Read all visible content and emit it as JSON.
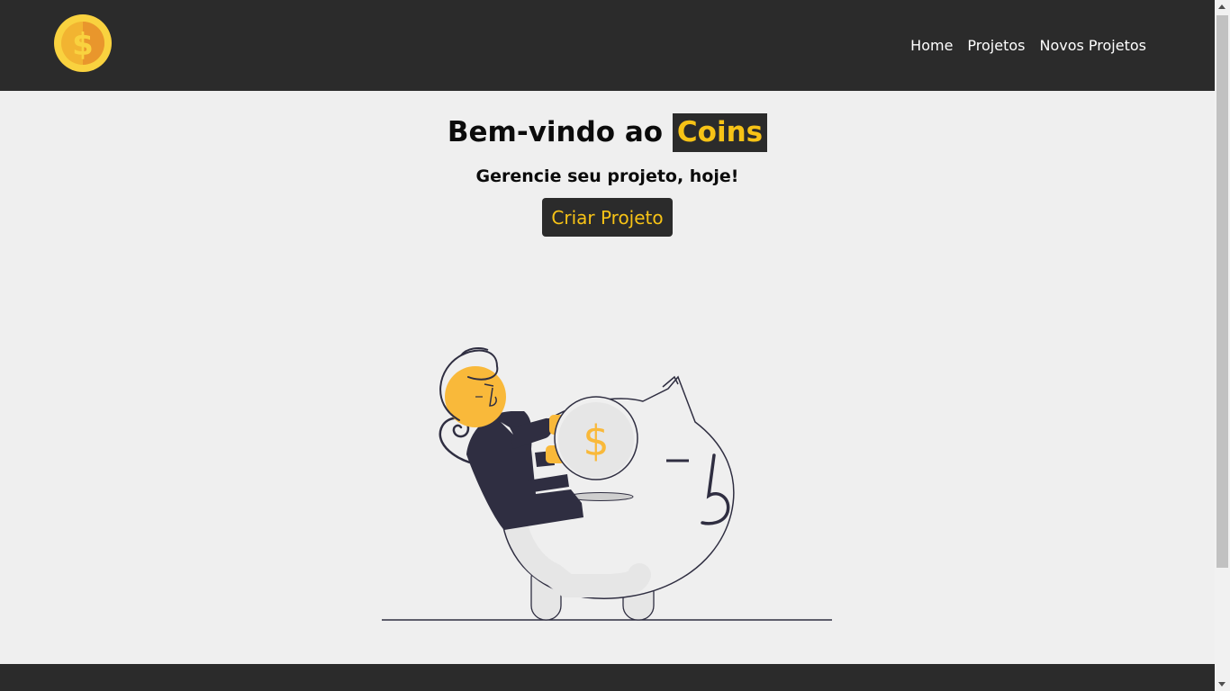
{
  "header": {
    "logo_icon": "dollar-coin-icon",
    "nav": [
      {
        "label": "Home"
      },
      {
        "label": "Projetos"
      },
      {
        "label": "Novos Projetos"
      }
    ]
  },
  "hero": {
    "title_prefix": "Bem-vindo ao",
    "title_brand": "Coins",
    "subtitle": "Gerencie seu projeto, hoje!",
    "cta_label": "Criar Projeto",
    "illustration_icon": "piggy-bank-illustration",
    "coin_symbol": "$"
  },
  "colors": {
    "dark": "#2b2b2b",
    "accent": "#f7c316",
    "background": "#efefef",
    "illustration_ink": "#2f2e41"
  }
}
